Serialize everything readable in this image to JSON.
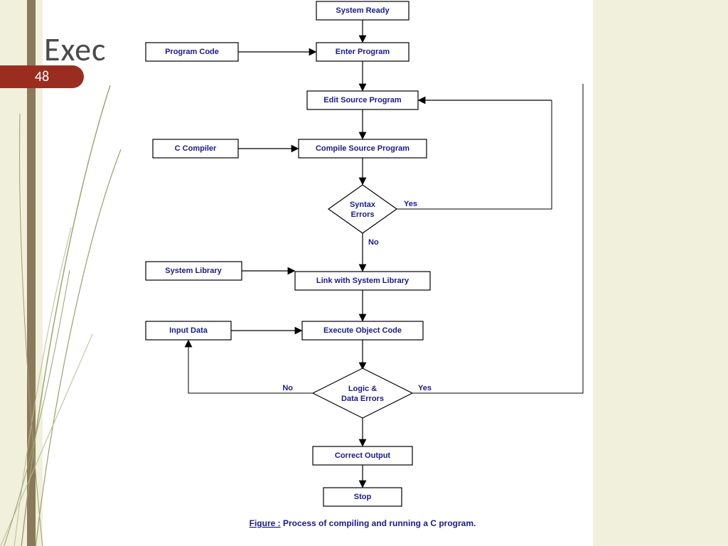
{
  "slide": {
    "title": "Exec",
    "page_number": "48"
  },
  "flowchart": {
    "nodes": {
      "system_ready": "System Ready",
      "enter_program": "Enter Program",
      "program_code": "Program Code",
      "edit_source": "Edit Source Program",
      "c_compiler": "C Compiler",
      "compile_source": "Compile Source Program",
      "syntax_errors": "Syntax",
      "syntax_errors2": "Errors",
      "system_library": "System Library",
      "link_lib": "Link with System Library",
      "input_data": "Input Data",
      "execute_obj": "Execute Object Code",
      "logic_errors": "Logic &",
      "logic_errors2": "Data Errors",
      "correct_output": "Correct Output",
      "stop": "Stop"
    },
    "edges": {
      "yes_syntax": "Yes",
      "no_syntax": "No",
      "yes_logic": "Yes",
      "no_logic": "No"
    },
    "caption_prefix": "Figure :",
    "caption_rest": " Process of compiling and running a C program."
  }
}
